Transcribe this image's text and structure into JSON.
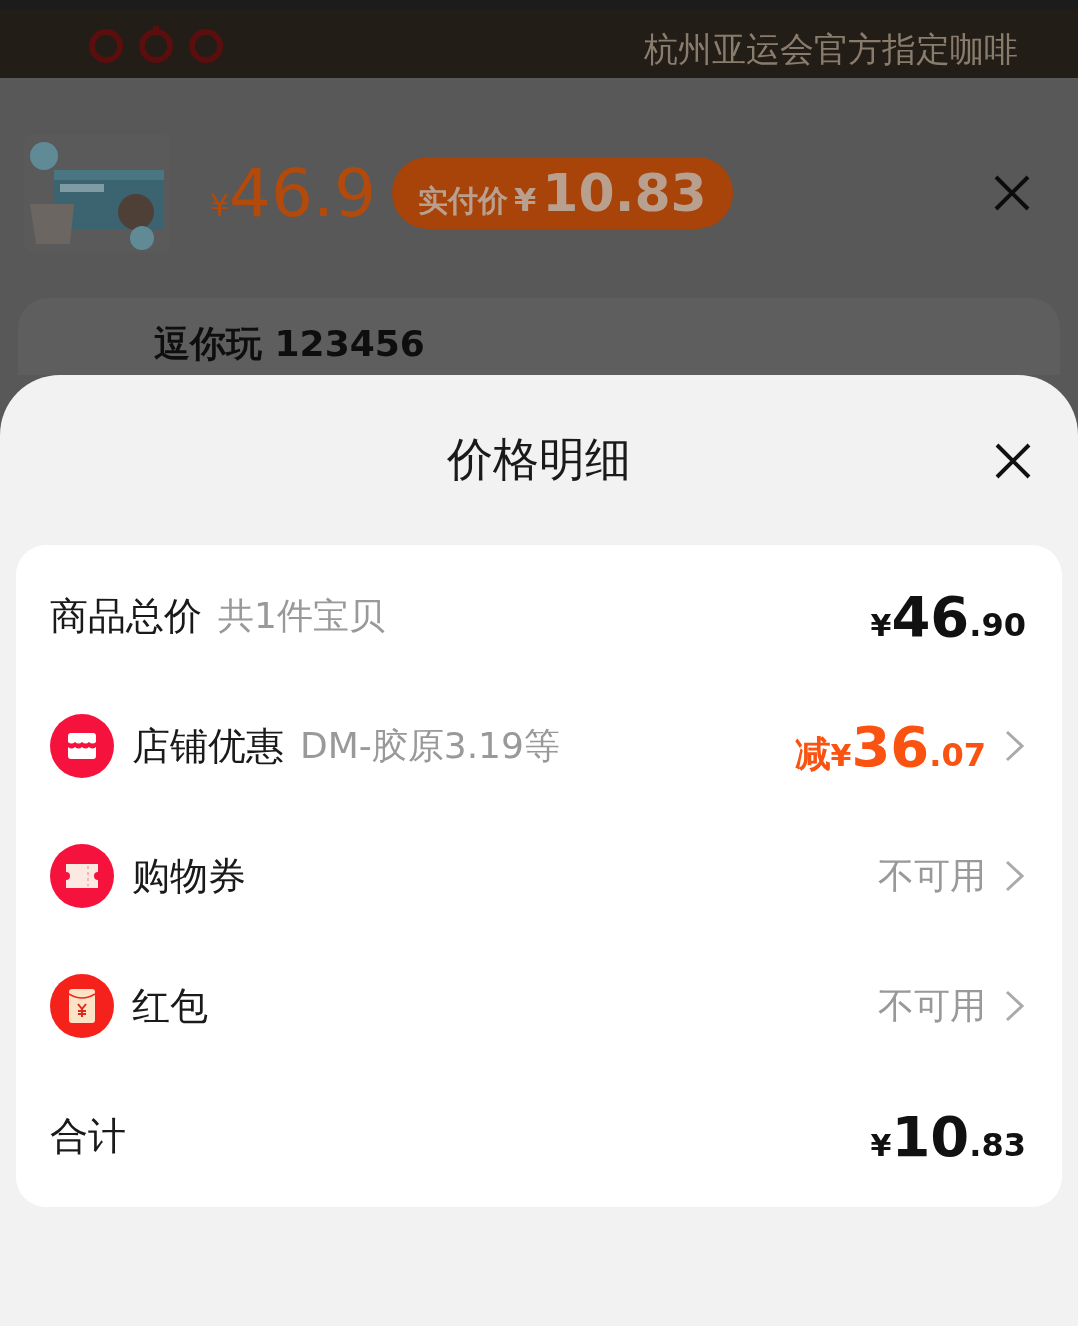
{
  "background": {
    "header": {
      "title": "杭州亚运会官方指定咖啡"
    },
    "product": {
      "kind": "picture",
      "price_currency": "¥",
      "price": "46.9",
      "badge_label": "实付价",
      "badge_currency": "¥",
      "badge_price": "10.83"
    },
    "shop_card": {
      "title": "逗你玩 123456"
    }
  },
  "sheet": {
    "title": "价格明细",
    "rows": [
      {
        "kind": "subtotal",
        "label": "商品总价",
        "note": "共1件宝贝",
        "currency": "¥",
        "integer": "46",
        "decimal": ".90"
      },
      {
        "kind": "shop_discount",
        "label": "店铺优惠",
        "note": "DM-胶原3.19等",
        "prefix": "减",
        "currency": "¥",
        "integer": "36",
        "decimal": ".07"
      },
      {
        "kind": "coupon",
        "label": "购物券",
        "status": "不可用"
      },
      {
        "kind": "red_packet",
        "label": "红包",
        "status": "不可用"
      },
      {
        "kind": "total",
        "label": "合计",
        "currency": "¥",
        "integer": "10",
        "decimal": ".83"
      }
    ]
  }
}
